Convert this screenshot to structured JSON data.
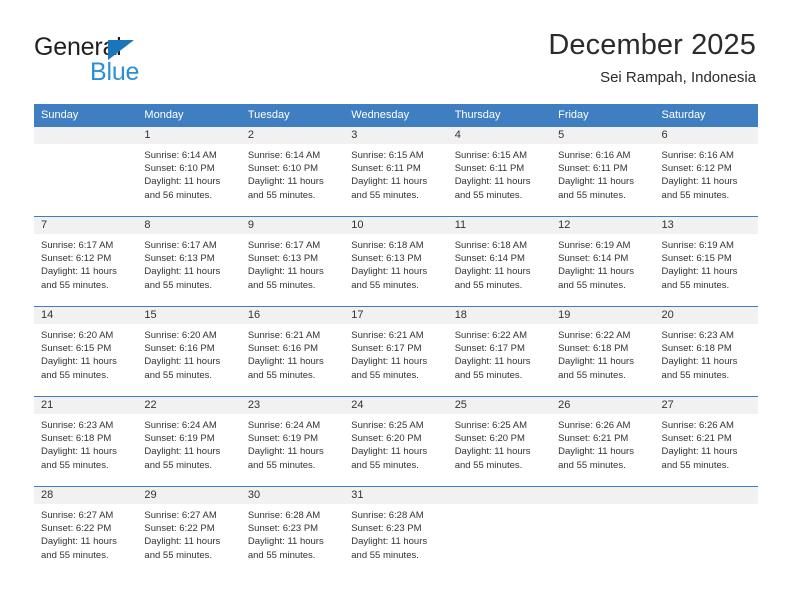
{
  "brand": {
    "name_part1": "General",
    "name_part2": "Blue",
    "logo_icon": "triangle-icon",
    "accent_dark": "#231f20",
    "accent_blue": "#1b75bb",
    "accent_light_blue": "#2b8fd6"
  },
  "header": {
    "title": "December 2025",
    "subtitle": "Sei Rampah, Indonesia",
    "header_bg": "#3f7fc1",
    "band_bg": "#f1f1f1"
  },
  "weekdays": [
    "Sunday",
    "Monday",
    "Tuesday",
    "Wednesday",
    "Thursday",
    "Friday",
    "Saturday"
  ],
  "weeks": [
    {
      "days": [
        {
          "num": "",
          "empty": true,
          "sunrise": "",
          "sunset": "",
          "daylight1": "",
          "daylight2": ""
        },
        {
          "num": "1",
          "empty": false,
          "sunrise": "Sunrise: 6:14 AM",
          "sunset": "Sunset: 6:10 PM",
          "daylight1": "Daylight: 11 hours",
          "daylight2": "and 56 minutes."
        },
        {
          "num": "2",
          "empty": false,
          "sunrise": "Sunrise: 6:14 AM",
          "sunset": "Sunset: 6:10 PM",
          "daylight1": "Daylight: 11 hours",
          "daylight2": "and 55 minutes."
        },
        {
          "num": "3",
          "empty": false,
          "sunrise": "Sunrise: 6:15 AM",
          "sunset": "Sunset: 6:11 PM",
          "daylight1": "Daylight: 11 hours",
          "daylight2": "and 55 minutes."
        },
        {
          "num": "4",
          "empty": false,
          "sunrise": "Sunrise: 6:15 AM",
          "sunset": "Sunset: 6:11 PM",
          "daylight1": "Daylight: 11 hours",
          "daylight2": "and 55 minutes."
        },
        {
          "num": "5",
          "empty": false,
          "sunrise": "Sunrise: 6:16 AM",
          "sunset": "Sunset: 6:11 PM",
          "daylight1": "Daylight: 11 hours",
          "daylight2": "and 55 minutes."
        },
        {
          "num": "6",
          "empty": false,
          "sunrise": "Sunrise: 6:16 AM",
          "sunset": "Sunset: 6:12 PM",
          "daylight1": "Daylight: 11 hours",
          "daylight2": "and 55 minutes."
        }
      ]
    },
    {
      "days": [
        {
          "num": "7",
          "empty": false,
          "sunrise": "Sunrise: 6:17 AM",
          "sunset": "Sunset: 6:12 PM",
          "daylight1": "Daylight: 11 hours",
          "daylight2": "and 55 minutes."
        },
        {
          "num": "8",
          "empty": false,
          "sunrise": "Sunrise: 6:17 AM",
          "sunset": "Sunset: 6:13 PM",
          "daylight1": "Daylight: 11 hours",
          "daylight2": "and 55 minutes."
        },
        {
          "num": "9",
          "empty": false,
          "sunrise": "Sunrise: 6:17 AM",
          "sunset": "Sunset: 6:13 PM",
          "daylight1": "Daylight: 11 hours",
          "daylight2": "and 55 minutes."
        },
        {
          "num": "10",
          "empty": false,
          "sunrise": "Sunrise: 6:18 AM",
          "sunset": "Sunset: 6:13 PM",
          "daylight1": "Daylight: 11 hours",
          "daylight2": "and 55 minutes."
        },
        {
          "num": "11",
          "empty": false,
          "sunrise": "Sunrise: 6:18 AM",
          "sunset": "Sunset: 6:14 PM",
          "daylight1": "Daylight: 11 hours",
          "daylight2": "and 55 minutes."
        },
        {
          "num": "12",
          "empty": false,
          "sunrise": "Sunrise: 6:19 AM",
          "sunset": "Sunset: 6:14 PM",
          "daylight1": "Daylight: 11 hours",
          "daylight2": "and 55 minutes."
        },
        {
          "num": "13",
          "empty": false,
          "sunrise": "Sunrise: 6:19 AM",
          "sunset": "Sunset: 6:15 PM",
          "daylight1": "Daylight: 11 hours",
          "daylight2": "and 55 minutes."
        }
      ]
    },
    {
      "days": [
        {
          "num": "14",
          "empty": false,
          "sunrise": "Sunrise: 6:20 AM",
          "sunset": "Sunset: 6:15 PM",
          "daylight1": "Daylight: 11 hours",
          "daylight2": "and 55 minutes."
        },
        {
          "num": "15",
          "empty": false,
          "sunrise": "Sunrise: 6:20 AM",
          "sunset": "Sunset: 6:16 PM",
          "daylight1": "Daylight: 11 hours",
          "daylight2": "and 55 minutes."
        },
        {
          "num": "16",
          "empty": false,
          "sunrise": "Sunrise: 6:21 AM",
          "sunset": "Sunset: 6:16 PM",
          "daylight1": "Daylight: 11 hours",
          "daylight2": "and 55 minutes."
        },
        {
          "num": "17",
          "empty": false,
          "sunrise": "Sunrise: 6:21 AM",
          "sunset": "Sunset: 6:17 PM",
          "daylight1": "Daylight: 11 hours",
          "daylight2": "and 55 minutes."
        },
        {
          "num": "18",
          "empty": false,
          "sunrise": "Sunrise: 6:22 AM",
          "sunset": "Sunset: 6:17 PM",
          "daylight1": "Daylight: 11 hours",
          "daylight2": "and 55 minutes."
        },
        {
          "num": "19",
          "empty": false,
          "sunrise": "Sunrise: 6:22 AM",
          "sunset": "Sunset: 6:18 PM",
          "daylight1": "Daylight: 11 hours",
          "daylight2": "and 55 minutes."
        },
        {
          "num": "20",
          "empty": false,
          "sunrise": "Sunrise: 6:23 AM",
          "sunset": "Sunset: 6:18 PM",
          "daylight1": "Daylight: 11 hours",
          "daylight2": "and 55 minutes."
        }
      ]
    },
    {
      "days": [
        {
          "num": "21",
          "empty": false,
          "sunrise": "Sunrise: 6:23 AM",
          "sunset": "Sunset: 6:18 PM",
          "daylight1": "Daylight: 11 hours",
          "daylight2": "and 55 minutes."
        },
        {
          "num": "22",
          "empty": false,
          "sunrise": "Sunrise: 6:24 AM",
          "sunset": "Sunset: 6:19 PM",
          "daylight1": "Daylight: 11 hours",
          "daylight2": "and 55 minutes."
        },
        {
          "num": "23",
          "empty": false,
          "sunrise": "Sunrise: 6:24 AM",
          "sunset": "Sunset: 6:19 PM",
          "daylight1": "Daylight: 11 hours",
          "daylight2": "and 55 minutes."
        },
        {
          "num": "24",
          "empty": false,
          "sunrise": "Sunrise: 6:25 AM",
          "sunset": "Sunset: 6:20 PM",
          "daylight1": "Daylight: 11 hours",
          "daylight2": "and 55 minutes."
        },
        {
          "num": "25",
          "empty": false,
          "sunrise": "Sunrise: 6:25 AM",
          "sunset": "Sunset: 6:20 PM",
          "daylight1": "Daylight: 11 hours",
          "daylight2": "and 55 minutes."
        },
        {
          "num": "26",
          "empty": false,
          "sunrise": "Sunrise: 6:26 AM",
          "sunset": "Sunset: 6:21 PM",
          "daylight1": "Daylight: 11 hours",
          "daylight2": "and 55 minutes."
        },
        {
          "num": "27",
          "empty": false,
          "sunrise": "Sunrise: 6:26 AM",
          "sunset": "Sunset: 6:21 PM",
          "daylight1": "Daylight: 11 hours",
          "daylight2": "and 55 minutes."
        }
      ]
    },
    {
      "days": [
        {
          "num": "28",
          "empty": false,
          "sunrise": "Sunrise: 6:27 AM",
          "sunset": "Sunset: 6:22 PM",
          "daylight1": "Daylight: 11 hours",
          "daylight2": "and 55 minutes."
        },
        {
          "num": "29",
          "empty": false,
          "sunrise": "Sunrise: 6:27 AM",
          "sunset": "Sunset: 6:22 PM",
          "daylight1": "Daylight: 11 hours",
          "daylight2": "and 55 minutes."
        },
        {
          "num": "30",
          "empty": false,
          "sunrise": "Sunrise: 6:28 AM",
          "sunset": "Sunset: 6:23 PM",
          "daylight1": "Daylight: 11 hours",
          "daylight2": "and 55 minutes."
        },
        {
          "num": "31",
          "empty": false,
          "sunrise": "Sunrise: 6:28 AM",
          "sunset": "Sunset: 6:23 PM",
          "daylight1": "Daylight: 11 hours",
          "daylight2": "and 55 minutes."
        },
        {
          "num": "",
          "empty": true,
          "sunrise": "",
          "sunset": "",
          "daylight1": "",
          "daylight2": ""
        },
        {
          "num": "",
          "empty": true,
          "sunrise": "",
          "sunset": "",
          "daylight1": "",
          "daylight2": ""
        },
        {
          "num": "",
          "empty": true,
          "sunrise": "",
          "sunset": "",
          "daylight1": "",
          "daylight2": ""
        }
      ]
    }
  ]
}
